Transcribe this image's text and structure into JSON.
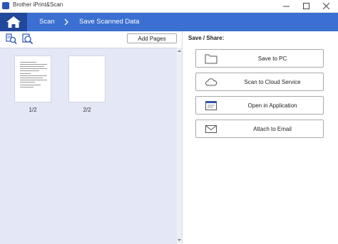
{
  "window": {
    "title": "Brother iPrint&Scan",
    "controls": [
      "minimize-icon",
      "maximize-icon",
      "close-icon"
    ]
  },
  "nav": {
    "home_icon": "home-icon",
    "breadcrumb": [
      "Scan",
      "Save Scanned Data"
    ],
    "bar_color": "#3b6fd1",
    "home_color": "#21489a"
  },
  "toolbar": {
    "icons": [
      "zoom-page-icon",
      "preview-zoom-icon"
    ],
    "add_pages_label": "Add Pages"
  },
  "pages": [
    {
      "label": "1/2",
      "has_text": true
    },
    {
      "label": "2/2",
      "has_text": false
    }
  ],
  "save_share": {
    "title": "Save / Share:",
    "buttons": [
      {
        "label": "Save to PC",
        "icon": "folder-icon"
      },
      {
        "label": "Scan to Cloud Service",
        "icon": "cloud-icon"
      },
      {
        "label": "Open in Application",
        "icon": "application-window-icon"
      },
      {
        "label": "Attach to Email",
        "icon": "envelope-icon"
      }
    ]
  }
}
